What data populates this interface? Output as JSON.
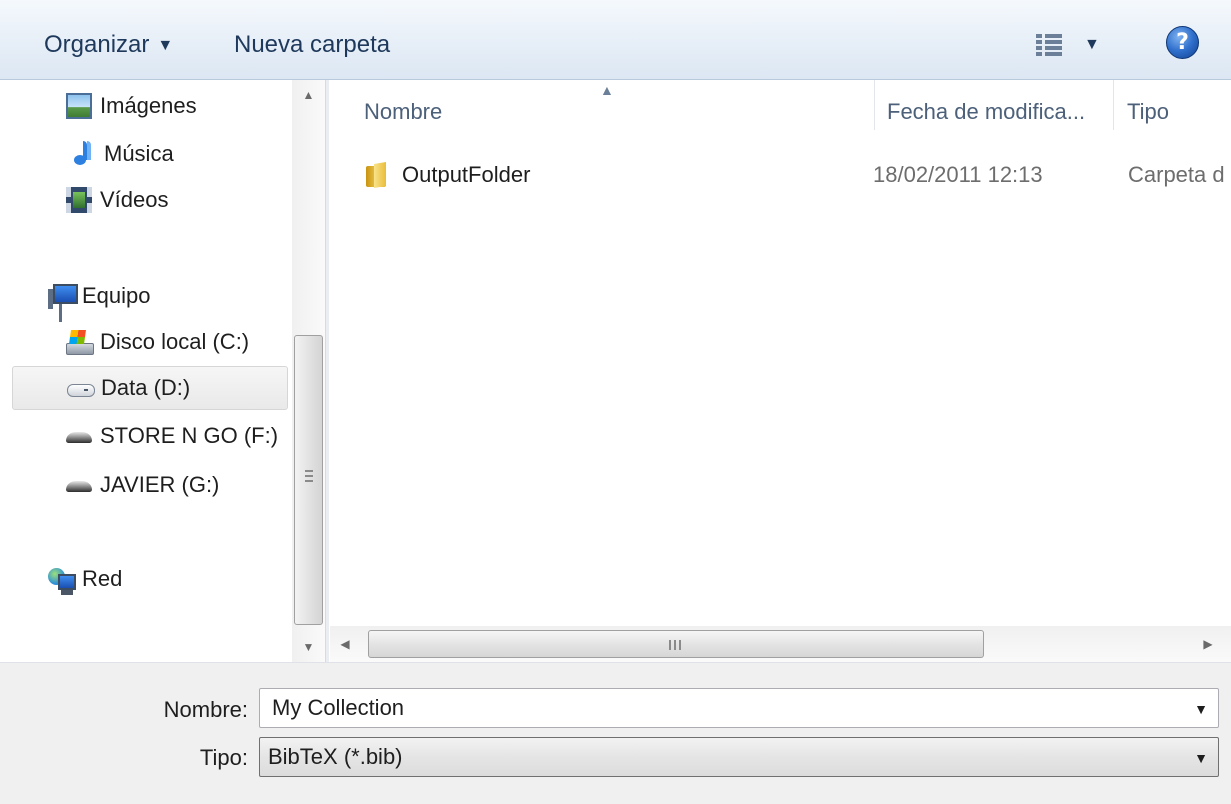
{
  "toolbar": {
    "organize_label": "Organizar",
    "new_folder_label": "Nueva carpeta",
    "views_icon": "views-list-icon",
    "help_label": "?"
  },
  "nav": {
    "items": [
      {
        "label": "Imágenes",
        "icon": "pictures-icon"
      },
      {
        "label": "Música",
        "icon": "music-icon"
      },
      {
        "label": "Vídeos",
        "icon": "videos-icon"
      },
      {
        "label": "Equipo",
        "icon": "computer-icon"
      },
      {
        "label": "Disco local (C:)",
        "icon": "local-disk-icon"
      },
      {
        "label": "Data (D:)",
        "icon": "drive-icon",
        "selected": true
      },
      {
        "label": "STORE N GO (F:)",
        "icon": "removable-drive-icon"
      },
      {
        "label": "JAVIER (G:)",
        "icon": "removable-drive-icon"
      },
      {
        "label": "Red",
        "icon": "network-icon"
      }
    ]
  },
  "file_list": {
    "columns": [
      "Nombre",
      "Fecha de modifica...",
      "Tipo"
    ],
    "rows": [
      {
        "name": "OutputFolder",
        "date": "18/02/2011 12:13",
        "type": "Carpeta d"
      }
    ]
  },
  "form": {
    "name_label": "Nombre:",
    "name_value": "My Collection",
    "type_label": "Tipo:",
    "type_value": "BibTeX (*.bib)"
  },
  "colors": {
    "toolbar_text": "#1e395b",
    "selection_bg": "#e9e9e9",
    "form_bg": "#f0f0f0"
  }
}
